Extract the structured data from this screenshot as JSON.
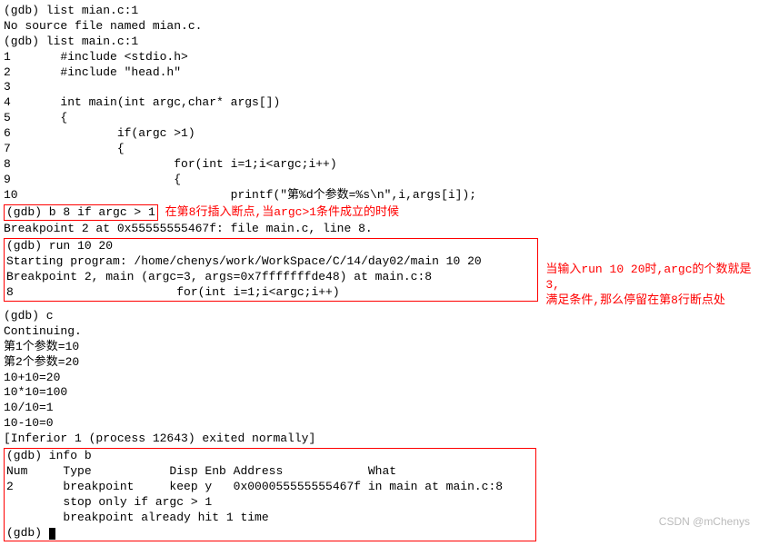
{
  "top": {
    "l1": "(gdb) list mian.c:1",
    "l2": "No source file named mian.c.",
    "l3": "(gdb) list main.c:1",
    "l4": "1       #include <stdio.h>",
    "l5": "2       #include \"head.h\"",
    "l6": "3",
    "l7": "4       int main(int argc,char* args[])",
    "l8": "5       {",
    "l9": "6               if(argc >1)",
    "l10": "7               {",
    "l11": "8                       for(int i=1;i<argc;i++)",
    "l12": "9                       {",
    "l13": "10                              printf(\"第%d个参数=%s\\n\",i,args[i]);"
  },
  "box1": {
    "cmd": "(gdb) b 8 if argc > 1",
    "anno": "在第8行插入断点,当argc>1条件成立的时候"
  },
  "mid1": "Breakpoint 2 at 0x55555555467f: file main.c, line 8.",
  "box2": {
    "l1": "(gdb) run 10 20",
    "l2": "Starting program: /home/chenys/work/WorkSpace/C/14/day02/main 10 20",
    "l3": "",
    "l4": "Breakpoint 2, main (argc=3, args=0x7fffffffde48) at main.c:8",
    "l5": "8                       for(int i=1;i<argc;i++)",
    "anno1": "当输入run 10 20时,argc的个数就是3,",
    "anno2": "满足条件,那么停留在第8行断点处"
  },
  "mid2": {
    "l1": "(gdb) c",
    "l2": "Continuing.",
    "l3": "第1个参数=10",
    "l4": "第2个参数=20",
    "l5": "10+10=20",
    "l6": "10*10=100",
    "l7": "10/10=1",
    "l8": "10-10=0",
    "l9": "[Inferior 1 (process 12643) exited normally]"
  },
  "box3": {
    "l1": "(gdb) info b",
    "l2": "Num     Type           Disp Enb Address            What",
    "l3": "2       breakpoint     keep y   0x000055555555467f in main at main.c:8",
    "l4": "        stop only if argc > 1",
    "l5": "        breakpoint already hit 1 time",
    "l6": "(gdb) "
  },
  "watermark": "CSDN @mChenys"
}
